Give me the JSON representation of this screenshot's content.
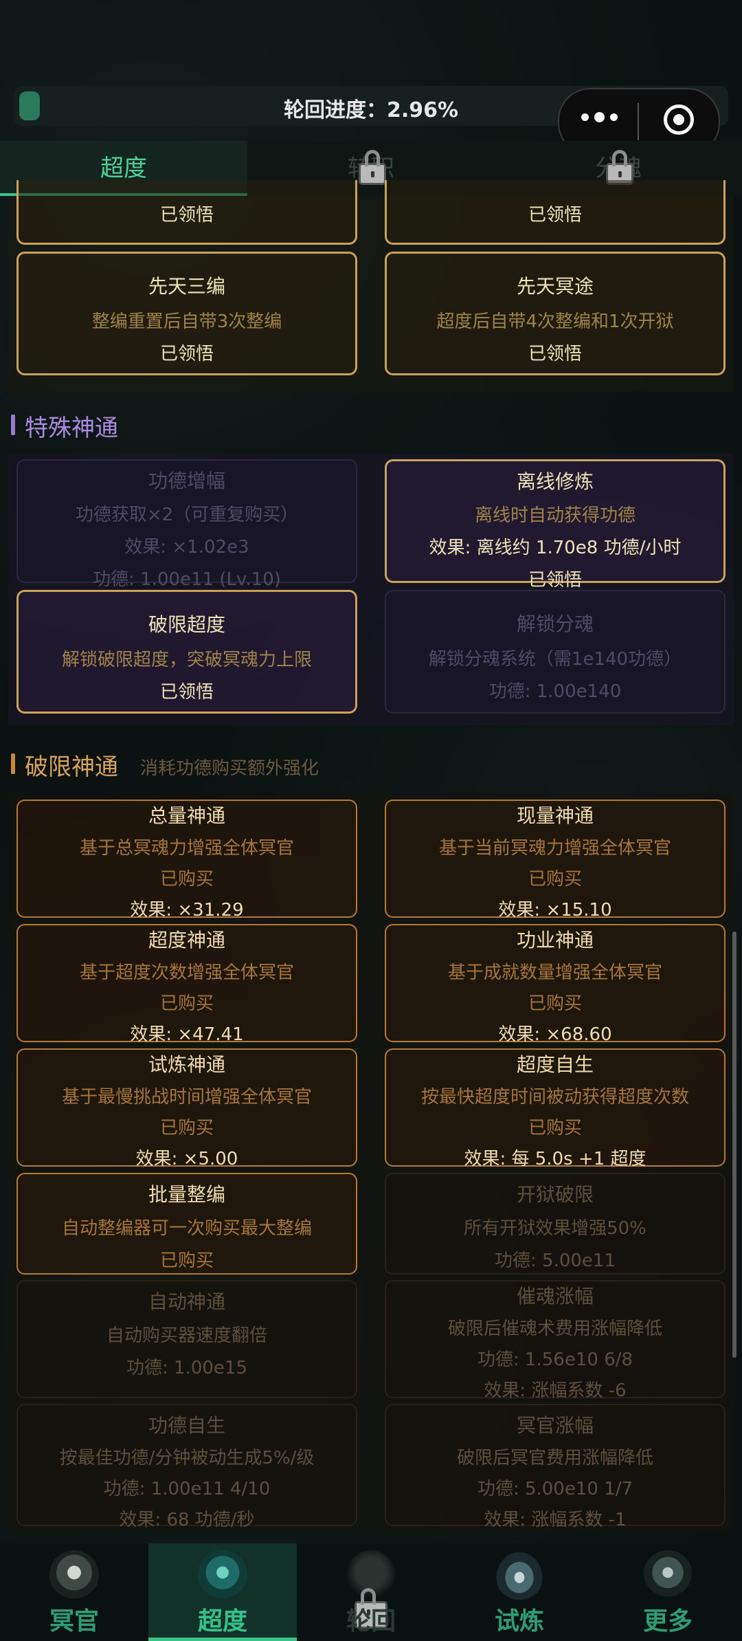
{
  "progress": {
    "label": "轮回进度：2.96%",
    "value": 2.96
  },
  "tabs": [
    {
      "label": "超度",
      "active": true
    },
    {
      "label": "转职",
      "locked": true
    },
    {
      "label": "分魂",
      "locked": true
    }
  ],
  "top_cards": [
    {
      "status": "已领悟"
    },
    {
      "status": "已领悟"
    },
    {
      "title": "先天三编",
      "desc": "整编重置后自带3次整编",
      "status": "已领悟"
    },
    {
      "title": "先天冥途",
      "desc": "超度后自带4次整编和1次开狱",
      "status": "已领悟"
    }
  ],
  "special": {
    "title": "特殊神通",
    "cards": [
      {
        "title": "功德增幅",
        "desc": "功德获取×2（可重复购买）",
        "effect": "效果: ×1.02e3",
        "cost": "功德: 1.00e11 (Lv.10)"
      },
      {
        "title": "离线修炼",
        "desc": "离线时自动获得功德",
        "effect": "效果: 离线约 1.70e8 功德/小时",
        "status": "已领悟"
      },
      {
        "title": "破限超度",
        "desc": "解锁破限超度，突破冥魂力上限",
        "status": "已领悟"
      },
      {
        "title": "解锁分魂",
        "desc": "解锁分魂系统（需1e140功德）",
        "cost": "功德: 1.00e140"
      }
    ]
  },
  "breakthrough": {
    "title": "破限神通",
    "subtitle": "消耗功德购买额外强化",
    "cards": [
      {
        "title": "总量神通",
        "desc": "基于总冥魂力增强全体冥官",
        "status": "已购买",
        "effect": "效果: ×31.29"
      },
      {
        "title": "现量神通",
        "desc": "基于当前冥魂力增强全体冥官",
        "status": "已购买",
        "effect": "效果: ×15.10"
      },
      {
        "title": "超度神通",
        "desc": "基于超度次数增强全体冥官",
        "status": "已购买",
        "effect": "效果: ×47.41"
      },
      {
        "title": "功业神通",
        "desc": "基于成就数量增强全体冥官",
        "status": "已购买",
        "effect": "效果: ×68.60"
      },
      {
        "title": "试炼神通",
        "desc": "基于最慢挑战时间增强全体冥官",
        "status": "已购买",
        "effect": "效果: ×5.00"
      },
      {
        "title": "超度自生",
        "desc": "按最快超度时间被动获得超度次数",
        "status": "已购买",
        "effect": "效果: 每 5.0s +1 超度"
      },
      {
        "title": "批量整编",
        "desc": "自动整编器可一次购买最大整编",
        "status": "已购买"
      },
      {
        "title": "开狱破限",
        "desc": "所有开狱效果增强50%",
        "cost": "功德: 5.00e11"
      },
      {
        "title": "自动神通",
        "desc": "自动购买器速度翻倍",
        "cost": "功德: 1.00e15"
      },
      {
        "title": "催魂涨幅",
        "desc": "破限后催魂术费用涨幅降低",
        "cost": "功德: 1.56e10 6/8",
        "effect": "效果: 涨幅系数 -6"
      },
      {
        "title": "功德自生",
        "desc": "按最佳功德/分钟被动生成5%/级",
        "cost": "功德: 1.00e11 4/10",
        "effect": "效果: 68 功德/秒"
      },
      {
        "title": "冥官涨幅",
        "desc": "破限后冥官费用涨幅降低",
        "cost": "功德: 5.00e10 1/7",
        "effect": "效果: 涨幅系数 -1"
      }
    ]
  },
  "bottom_nav": [
    {
      "label": "冥官",
      "color": "#2f9c76",
      "icon": "mask-icon"
    },
    {
      "label": "超度",
      "color": "#34c28a",
      "icon": "demon-icon",
      "active": true
    },
    {
      "label": "轮回",
      "color": "#2c3a35",
      "icon": "lock-icon",
      "locked": true
    },
    {
      "label": "试炼",
      "color": "#2f9c76",
      "icon": "flame-icon"
    },
    {
      "label": "更多",
      "color": "#2f9c76",
      "icon": "spade-icon"
    }
  ]
}
